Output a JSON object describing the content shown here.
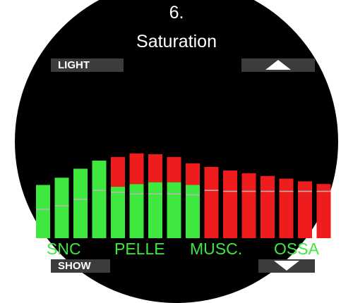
{
  "screen": {
    "page_number": "6.",
    "title": "Saturation"
  },
  "softkeys": {
    "top_left": "LIGHT",
    "top_right_icon": "up-arrow-icon",
    "bottom_left": "SHOW",
    "bottom_right_icon": "down-arrow-icon"
  },
  "tissue_labels": [
    "SNC",
    "PELLE",
    "MUSC.",
    "OSSA"
  ],
  "colors": {
    "background": "#000000",
    "softkey": "#3c3c3c",
    "text": "#ffffff",
    "green": "#3fe83f",
    "red": "#ee1c1c",
    "label": "#3fe83f"
  },
  "chart_data": {
    "type": "bar",
    "categories": [
      "1",
      "2",
      "3",
      "4",
      "5",
      "6",
      "7",
      "8",
      "9",
      "10",
      "11",
      "12",
      "13",
      "14",
      "15",
      "16"
    ],
    "series": [
      {
        "name": "",
        "values": [
          0.59,
          0.67,
          0.77,
          0.86,
          0.9,
          0.94,
          0.93,
          0.9,
          0.83,
          0.79,
          0.75,
          0.72,
          0.69,
          0.66,
          0.63,
          0.6
        ]
      }
    ],
    "green_portion": [
      0.59,
      0.67,
      0.77,
      0.86,
      0.57,
      0.6,
      0.62,
      0.62,
      0.59,
      0.0,
      0.0,
      0.0,
      0.0,
      0.0,
      0.0,
      0.0
    ],
    "marker_level": [
      0.32,
      0.36,
      0.43,
      0.53,
      0.51,
      0.49,
      0.49,
      0.49,
      0.48,
      0.53,
      0.52,
      0.52,
      0.52,
      0.52,
      0.52,
      0.52
    ],
    "ylim": [
      0,
      1
    ],
    "grid": false
  }
}
